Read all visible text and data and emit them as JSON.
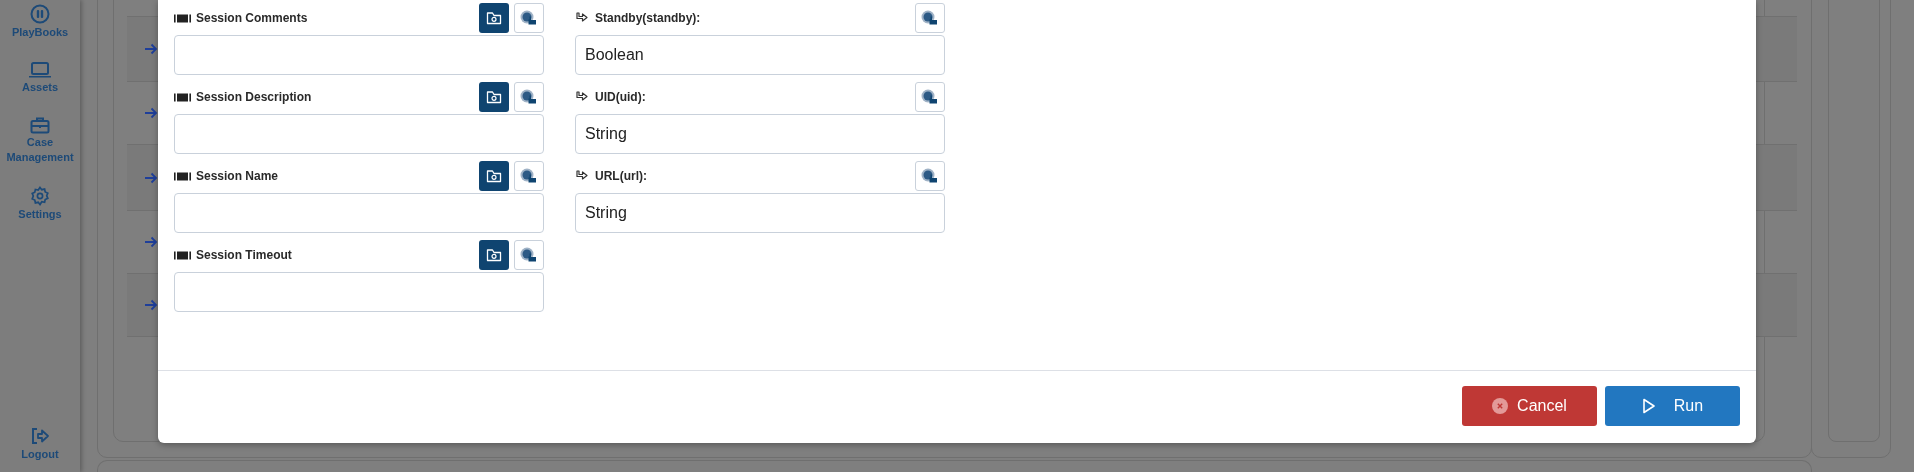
{
  "sidebar": {
    "items": [
      {
        "label": "PlayBooks"
      },
      {
        "label": "Assets"
      },
      {
        "label": "Case Management"
      },
      {
        "label": "Settings"
      }
    ],
    "logout": {
      "label": "Logout"
    }
  },
  "form": {
    "left_fields": [
      {
        "label": "Session Comments",
        "kind": "variable"
      },
      {
        "label": "Session Description",
        "kind": "variable"
      },
      {
        "label": "Session Name",
        "kind": "variable"
      },
      {
        "label": "Session Timeout",
        "kind": "variable"
      }
    ],
    "right_fields": [
      {
        "label": "Standby(standby):",
        "kind": "argument",
        "value": "Boolean"
      },
      {
        "label": "UID(uid):",
        "kind": "argument",
        "value": "String"
      },
      {
        "label": "URL(url):",
        "kind": "argument",
        "value": "String"
      }
    ]
  },
  "footer": {
    "buttons": [
      {
        "label": "Cancel",
        "kind": "cancel"
      },
      {
        "label": "Run",
        "kind": "run"
      }
    ]
  }
}
